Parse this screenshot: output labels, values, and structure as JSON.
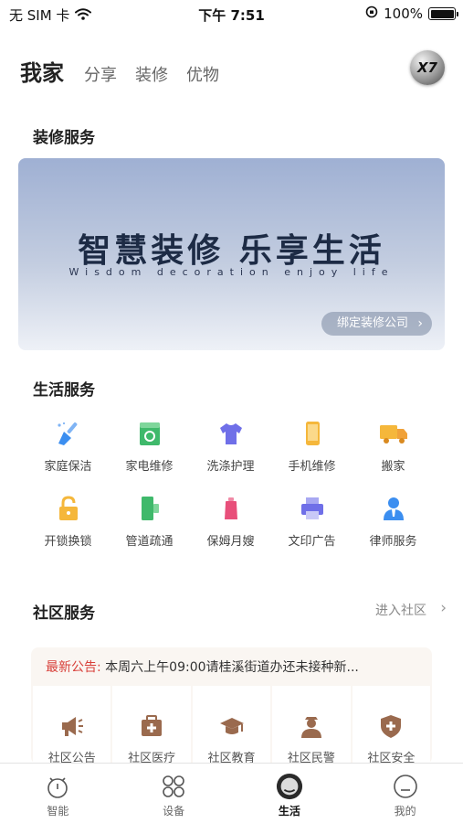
{
  "status_bar": {
    "carrier": "无 SIM 卡",
    "time": "下午 7:51",
    "battery_percent": "100%"
  },
  "top_nav": {
    "tabs": [
      {
        "label": "我家",
        "active": true
      },
      {
        "label": "分享",
        "active": false
      },
      {
        "label": "装修",
        "active": false
      },
      {
        "label": "优物",
        "active": false
      }
    ],
    "avatar_text": "X7"
  },
  "decoration": {
    "section_title": "装修服务",
    "banner_title": "智慧装修 乐享生活",
    "banner_subtitle": "Wisdom decoration enjoy life",
    "bind_button": "绑定装修公司"
  },
  "life_services": {
    "section_title": "生活服务",
    "items": [
      {
        "label": "家庭保洁",
        "icon": "broom-icon",
        "color": "#3b8ef0"
      },
      {
        "label": "家电维修",
        "icon": "washing-machine-icon",
        "color": "#3fb96b"
      },
      {
        "label": "洗涤护理",
        "icon": "tshirt-icon",
        "color": "#6f6fe8"
      },
      {
        "label": "手机维修",
        "icon": "phone-icon",
        "color": "#f5b73b"
      },
      {
        "label": "搬家",
        "icon": "truck-icon",
        "color": "#f5b73b"
      },
      {
        "label": "开锁换锁",
        "icon": "lock-icon",
        "color": "#f5b73b"
      },
      {
        "label": "管道疏通",
        "icon": "pipe-icon",
        "color": "#3fb96b"
      },
      {
        "label": "保姆月嫂",
        "icon": "bottle-icon",
        "color": "#e84f7a"
      },
      {
        "label": "文印广告",
        "icon": "printer-icon",
        "color": "#6f6fe8"
      },
      {
        "label": "律师服务",
        "icon": "lawyer-icon",
        "color": "#3b8ef0"
      }
    ]
  },
  "community": {
    "section_title": "社区服务",
    "enter_link": "进入社区",
    "notice_label": "最新公告:",
    "notice_text": "本周六上午09:00请桂溪街道办还未接种新...",
    "items": [
      {
        "label": "社区公告",
        "icon": "megaphone-icon"
      },
      {
        "label": "社区医疗",
        "icon": "medical-kit-icon"
      },
      {
        "label": "社区教育",
        "icon": "graduation-cap-icon"
      },
      {
        "label": "社区民警",
        "icon": "police-icon"
      },
      {
        "label": "社区安全",
        "icon": "shield-icon"
      }
    ],
    "icon_color": "#9a6a4e"
  },
  "tab_bar": {
    "items": [
      {
        "label": "智能",
        "icon": "smart-robot-icon",
        "active": false
      },
      {
        "label": "设备",
        "icon": "devices-grid-icon",
        "active": false
      },
      {
        "label": "生活",
        "icon": "life-icon",
        "active": true
      },
      {
        "label": "我的",
        "icon": "profile-icon",
        "active": false
      }
    ]
  }
}
